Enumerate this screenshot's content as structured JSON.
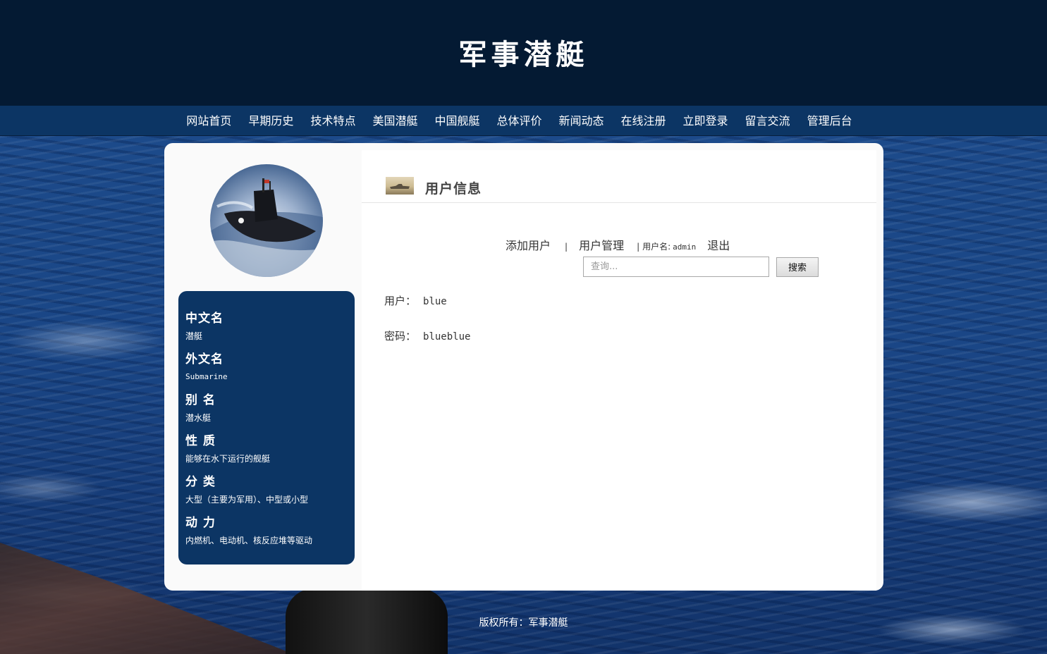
{
  "site": {
    "title": "军事潜艇"
  },
  "nav": {
    "items": [
      {
        "label": "网站首页"
      },
      {
        "label": "早期历史"
      },
      {
        "label": "技术特点"
      },
      {
        "label": "美国潜艇"
      },
      {
        "label": "中国舰艇"
      },
      {
        "label": "总体评价"
      },
      {
        "label": "新闻动态"
      },
      {
        "label": "在线注册"
      },
      {
        "label": "立即登录"
      },
      {
        "label": "留言交流"
      },
      {
        "label": "管理后台"
      }
    ]
  },
  "sidebar": {
    "info": [
      {
        "term": "中文名",
        "desc": "潜艇"
      },
      {
        "term": "外文名",
        "desc": "Submarine"
      },
      {
        "term": "别 名",
        "desc": "潜水艇"
      },
      {
        "term": "性 质",
        "desc": "能够在水下运行的舰艇"
      },
      {
        "term": "分 类",
        "desc": "大型（主要为军用）、中型或小型"
      },
      {
        "term": "动 力",
        "desc": "内燃机、电动机、核反应堆等驱动"
      }
    ]
  },
  "content": {
    "title": "用户信息",
    "actions": {
      "add_user": "添加用户",
      "separator": "|",
      "manage_users": "用户管理",
      "username_label": "用户名:",
      "username": "admin",
      "logout": "退出"
    },
    "search": {
      "placeholder": "查询...",
      "button": "搜索"
    },
    "user": {
      "user_label": "用户：",
      "user_value": "blue",
      "password_label": "密码：",
      "password_value": "blueblue"
    }
  },
  "footer": {
    "text": "版权所有：军事潜艇"
  },
  "colors": {
    "header_bg": "#041a33",
    "nav_bg": "#0c3564",
    "panel_bg": "#0c3564",
    "card_bg": "#fafafa"
  },
  "icons": {
    "avatar": "submarine-photo",
    "section": "ship-thumbnail"
  }
}
